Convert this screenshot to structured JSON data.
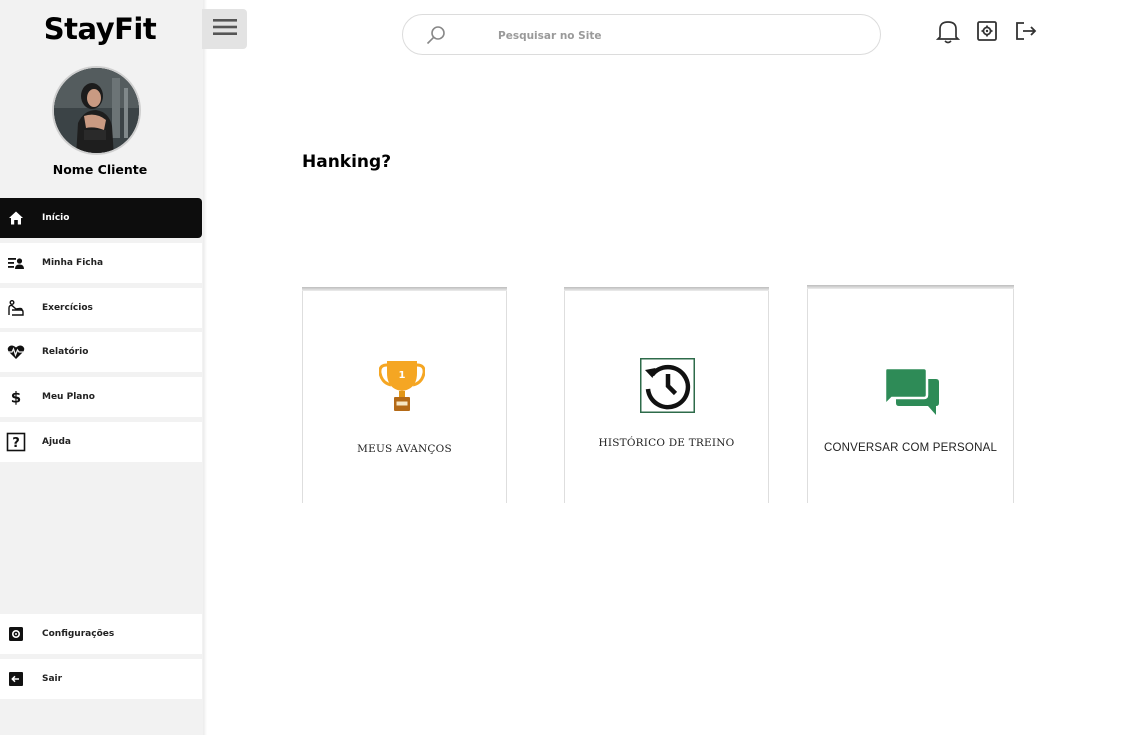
{
  "app": {
    "brand": "StayFit"
  },
  "user": {
    "name": "Nome Cliente"
  },
  "sidebar": {
    "items": [
      {
        "label": "Início",
        "icon": "home-icon",
        "active": true
      },
      {
        "label": "Minha Ficha",
        "icon": "user-list-icon",
        "active": false
      },
      {
        "label": "Exercícios",
        "icon": "exercise-icon",
        "active": false
      },
      {
        "label": "Relatório",
        "icon": "heart-pulse-icon",
        "active": false
      },
      {
        "label": "Meu Plano",
        "icon": "dollar-icon",
        "active": false
      },
      {
        "label": "Ajuda",
        "icon": "help-icon",
        "active": false
      }
    ],
    "bottom_items": [
      {
        "label": "Configurações",
        "icon": "gear-icon"
      },
      {
        "label": "Sair",
        "icon": "exit-icon"
      }
    ]
  },
  "search": {
    "placeholder": "Pesquisar no Site"
  },
  "header_icons": [
    "bell-icon",
    "settings-icon",
    "logout-icon"
  ],
  "main": {
    "heading": "Hanking?",
    "cards": [
      {
        "label": "MEUS  AVANÇOS",
        "icon": "trophy-icon"
      },
      {
        "label": "HISTÓRICO DE TREINO",
        "icon": "history-icon"
      },
      {
        "label": "CONVERSAR COM PERSONAL",
        "icon": "chat-icon"
      }
    ]
  },
  "colors": {
    "active_nav": "#0d0d0d",
    "sidebar_bg": "#f2f2f2",
    "trophy": "#f5a623",
    "chat": "#2e8b57"
  }
}
